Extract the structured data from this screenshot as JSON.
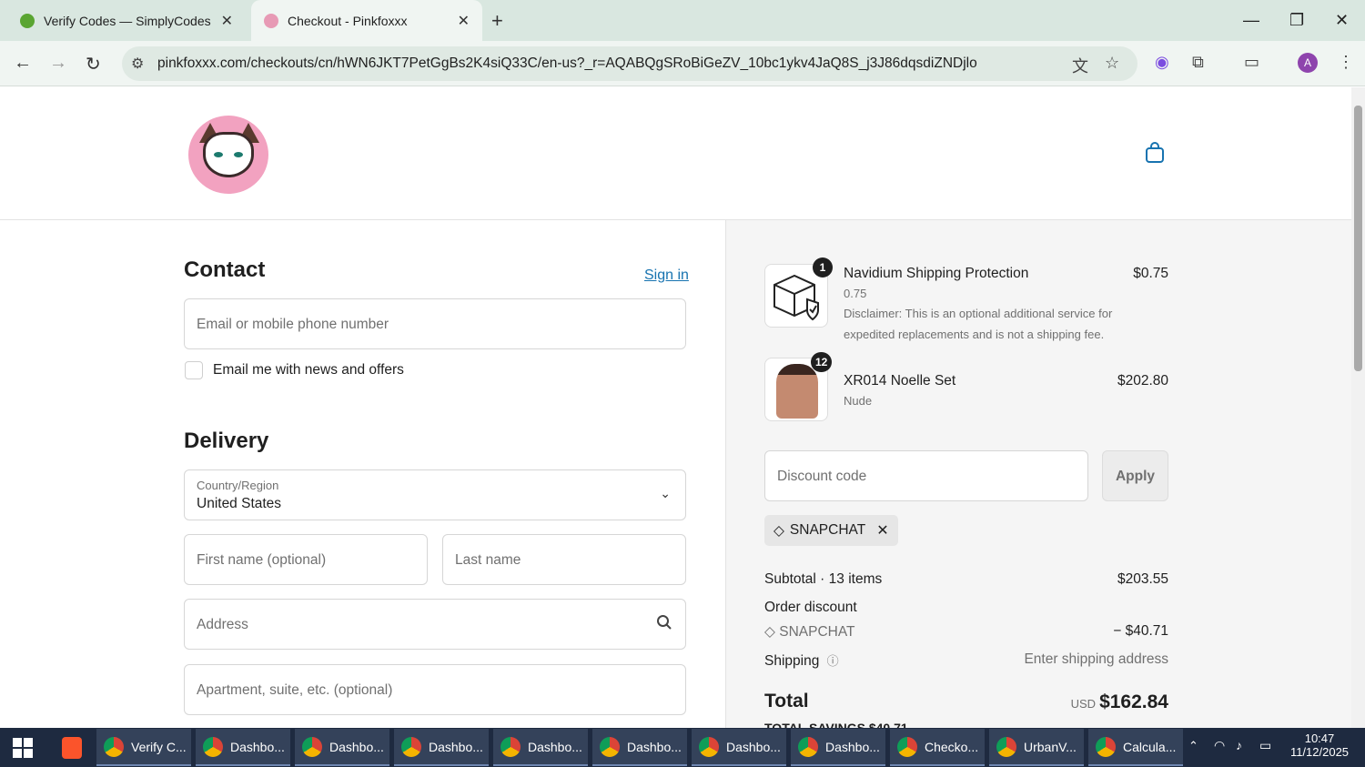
{
  "browser": {
    "tabs": [
      {
        "title": "Verify Codes — SimplyCodes"
      },
      {
        "title": "Checkout - Pinkfoxxx"
      }
    ],
    "url": "pinkfoxxx.com/checkouts/cn/hWN6JKT7PetGgBs2K4siQ33C/en-us?_r=AQABQgSRoBiGeZV_10bc1ykv4JaQ8S_j3J86dqsdiZNDjlo",
    "profile_initial": "A"
  },
  "contact": {
    "heading": "Contact",
    "sign_in": "Sign in",
    "email_placeholder": "Email or mobile phone number",
    "newsletter_label": "Email me with news and offers"
  },
  "delivery": {
    "heading": "Delivery",
    "country_label": "Country/Region",
    "country_value": "United States",
    "first_name_placeholder": "First name (optional)",
    "last_name_placeholder": "Last name",
    "address_placeholder": "Address",
    "apartment_placeholder": "Apartment, suite, etc. (optional)"
  },
  "order": {
    "items": [
      {
        "name": "Navidium Shipping Protection",
        "variant": "0.75",
        "note_line1": "Disclaimer: This is an optional additional service for",
        "note_line2": "expedited replacements and is not a shipping fee.",
        "price": "$0.75",
        "quantity": "1"
      },
      {
        "name": "XR014 Noelle Set",
        "variant": "Nude",
        "price": "$202.80",
        "quantity": "12"
      }
    ],
    "discount_placeholder": "Discount code",
    "apply_label": "Apply",
    "applied_code": "SNAPCHAT",
    "subtotal_label": "Subtotal · 13 items",
    "subtotal_value": "$203.55",
    "order_discount_label": "Order discount",
    "discount_code_label": "SNAPCHAT",
    "discount_value": "− $40.71",
    "shipping_label": "Shipping",
    "shipping_value": "Enter shipping address",
    "total_label": "Total",
    "currency": "USD",
    "total_value": "$162.84",
    "savings_partial": "TOTAL SAVINGS  $40.71"
  },
  "taskbar": {
    "items": [
      {
        "label": "Verify C..."
      },
      {
        "label": "Dashbo..."
      },
      {
        "label": "Dashbo..."
      },
      {
        "label": "Dashbo..."
      },
      {
        "label": "Dashbo..."
      },
      {
        "label": "Dashbo..."
      },
      {
        "label": "Dashbo..."
      },
      {
        "label": "Dashbo..."
      },
      {
        "label": "Checko..."
      },
      {
        "label": "UrbanV..."
      },
      {
        "label": "Calcula..."
      }
    ],
    "time": "10:47",
    "date": "11/12/2025"
  },
  "colors": {
    "link": "#1773b0",
    "chrome_bg": "#d9e7e0",
    "taskbar_bg": "#1e2a40"
  }
}
